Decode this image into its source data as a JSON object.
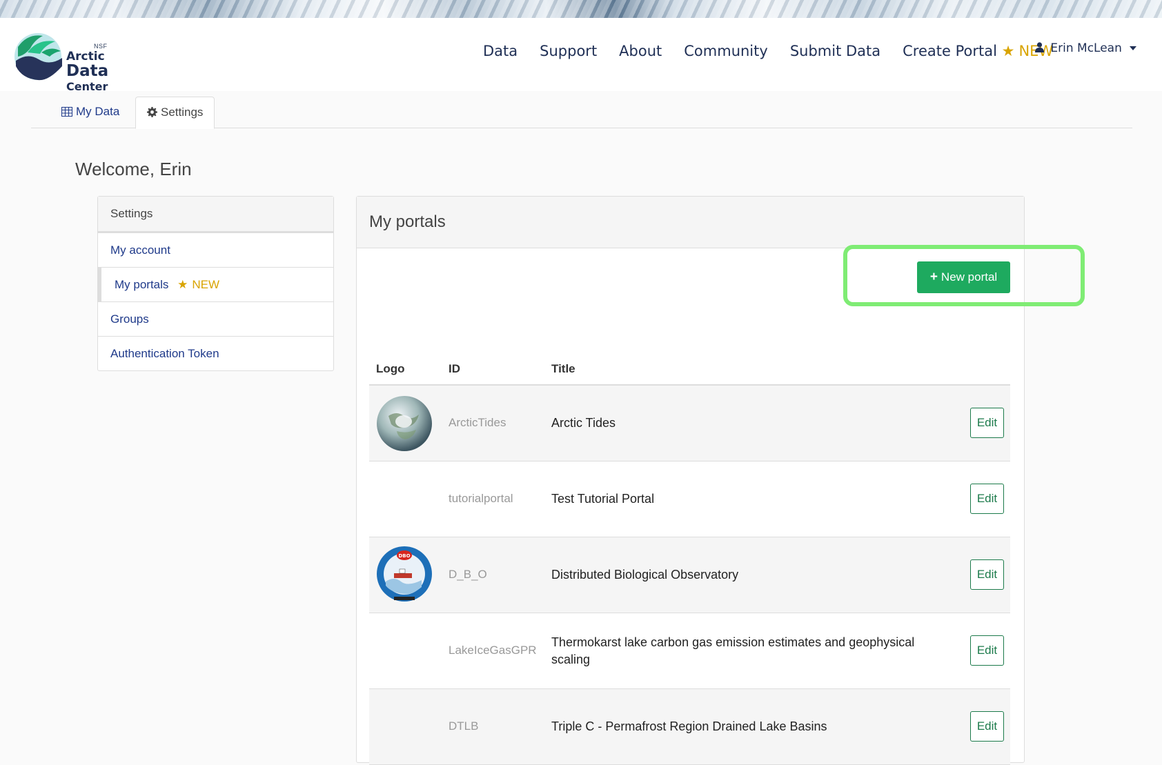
{
  "header": {
    "logo": {
      "nsf": "NSF",
      "line1": "Arctic",
      "line2": "Data",
      "line3": "Center"
    },
    "nav": [
      "Data",
      "Support",
      "About",
      "Community",
      "Submit Data"
    ],
    "create_portal": "Create Portal",
    "new_badge": "NEW",
    "user_name": "Erin McLean"
  },
  "tabs": {
    "my_data": "My Data",
    "settings": "Settings"
  },
  "welcome": "Welcome, Erin",
  "settings_panel": {
    "heading": "Settings",
    "items": [
      "My account",
      "My portals",
      "Groups",
      "Authentication Token"
    ],
    "new_badge": "NEW"
  },
  "portals_panel": {
    "heading": "My portals",
    "new_portal_label": "New portal",
    "columns": [
      "Logo",
      "ID",
      "Title"
    ],
    "edit_label": "Edit",
    "rows": [
      {
        "id": "ArcticTides",
        "title": "Arctic Tides",
        "logo": "globe-logo"
      },
      {
        "id": "tutorialportal",
        "title": "Test Tutorial Portal",
        "logo": ""
      },
      {
        "id": "D_B_O",
        "title": "Distributed Biological Observatory",
        "logo": "dbo-logo"
      },
      {
        "id": "LakeIceGasGPR",
        "title": "Thermokarst lake carbon gas emission estimates and geophysical scaling",
        "logo": ""
      },
      {
        "id": "DTLB",
        "title": "Triple C - Permafrost Region Drained Lake Basins",
        "logo": ""
      }
    ]
  },
  "colors": {
    "accent_green": "#1eaa5f",
    "new_gold": "#d9a400",
    "nav_navy": "#1f2f55",
    "highlight": "#7fec74"
  }
}
